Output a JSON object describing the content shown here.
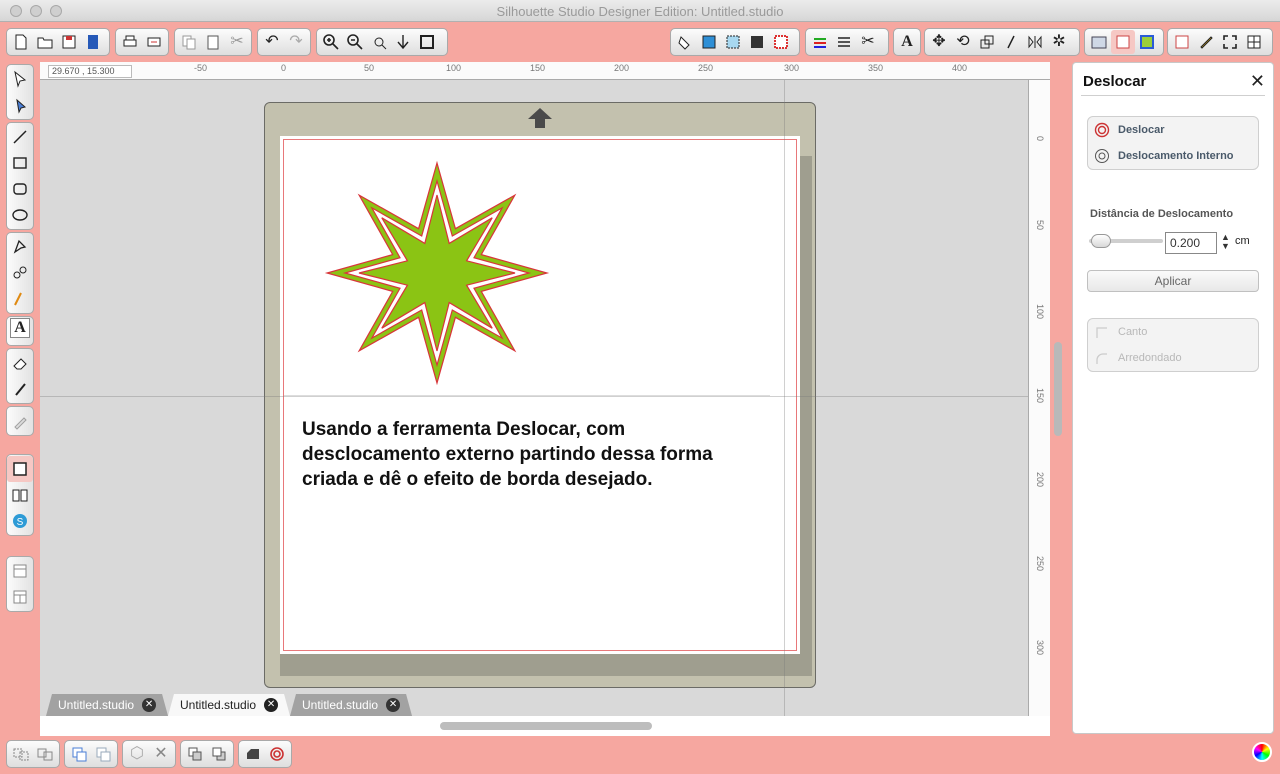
{
  "window": {
    "title": "Silhouette Studio Designer Edition: Untitled.studio"
  },
  "toolbar": {
    "groups": [
      {
        "name": "file",
        "icons": [
          "new-document-icon",
          "open-folder-icon",
          "save-icon",
          "save-to-sd-icon"
        ]
      },
      {
        "name": "print",
        "icons": [
          "print-icon",
          "print-cut-icon"
        ]
      },
      {
        "name": "clipboard",
        "icons": [
          "copy-icon",
          "paste-icon",
          "cut-icon"
        ]
      },
      {
        "name": "history",
        "icons": [
          "undo-icon",
          "redo-icon"
        ]
      },
      {
        "name": "zoom",
        "icons": [
          "zoom-in-icon",
          "zoom-out-icon",
          "zoom-select-icon",
          "pan-icon",
          "fit-page-icon"
        ]
      },
      {
        "name": "style",
        "icons": [
          "fill-color-icon",
          "fill-gradient-icon",
          "fill-pattern-icon",
          "fill-texture-icon",
          "line-color-icon",
          "line-style-icon",
          "cut-style-icon"
        ]
      },
      {
        "name": "text",
        "icons": [
          "text-style-icon"
        ]
      },
      {
        "name": "transform",
        "icons": [
          "move-icon",
          "rotate-icon",
          "scale-icon",
          "shear-icon",
          "mirror-icon",
          "replicate-icon"
        ]
      },
      {
        "name": "panels",
        "icons": [
          "library-icon",
          "offset-panel-icon",
          "trace-icon"
        ]
      },
      {
        "name": "view",
        "icons": [
          "page-setup-icon",
          "sketch-icon",
          "fullscreen-icon",
          "grid-icon"
        ]
      }
    ]
  },
  "ruler": {
    "coords": "29.670 , 15.300",
    "top_ticks": [
      "-50",
      "0",
      "50",
      "100",
      "150",
      "200",
      "250",
      "300",
      "350",
      "400"
    ],
    "right_ticks": [
      "0",
      "50",
      "100",
      "150",
      "200",
      "250",
      "300"
    ]
  },
  "canvas": {
    "caption": "Usando a ferramenta Deslocar, com desclocamento externo partindo dessa forma criada e dê o efeito de borda desejado.",
    "shape_colors": {
      "fill": "#8bc414",
      "outline": "#d8353a",
      "offset_fill": "#ffffff"
    }
  },
  "tabs": [
    {
      "label": "Untitled.studio",
      "active": false
    },
    {
      "label": "Untitled.studio",
      "active": true
    },
    {
      "label": "Untitled.studio",
      "active": false
    }
  ],
  "panel": {
    "title": "Deslocar",
    "options": [
      {
        "label": "Deslocar",
        "icon": "offset-icon"
      },
      {
        "label": "Deslocamento Interno",
        "icon": "internal-offset-icon"
      }
    ],
    "distance_label": "Distância de Deslocamento",
    "distance_value": "0.200",
    "distance_unit": "cm",
    "apply_label": "Aplicar",
    "corner_options": [
      {
        "label": "Canto",
        "icon": "corner-icon"
      },
      {
        "label": "Arredondado",
        "icon": "rounded-icon"
      }
    ]
  },
  "colors": {
    "chrome": "#f6a7a0",
    "mat": "#c3c1ae",
    "page_border": "#e8787a"
  }
}
